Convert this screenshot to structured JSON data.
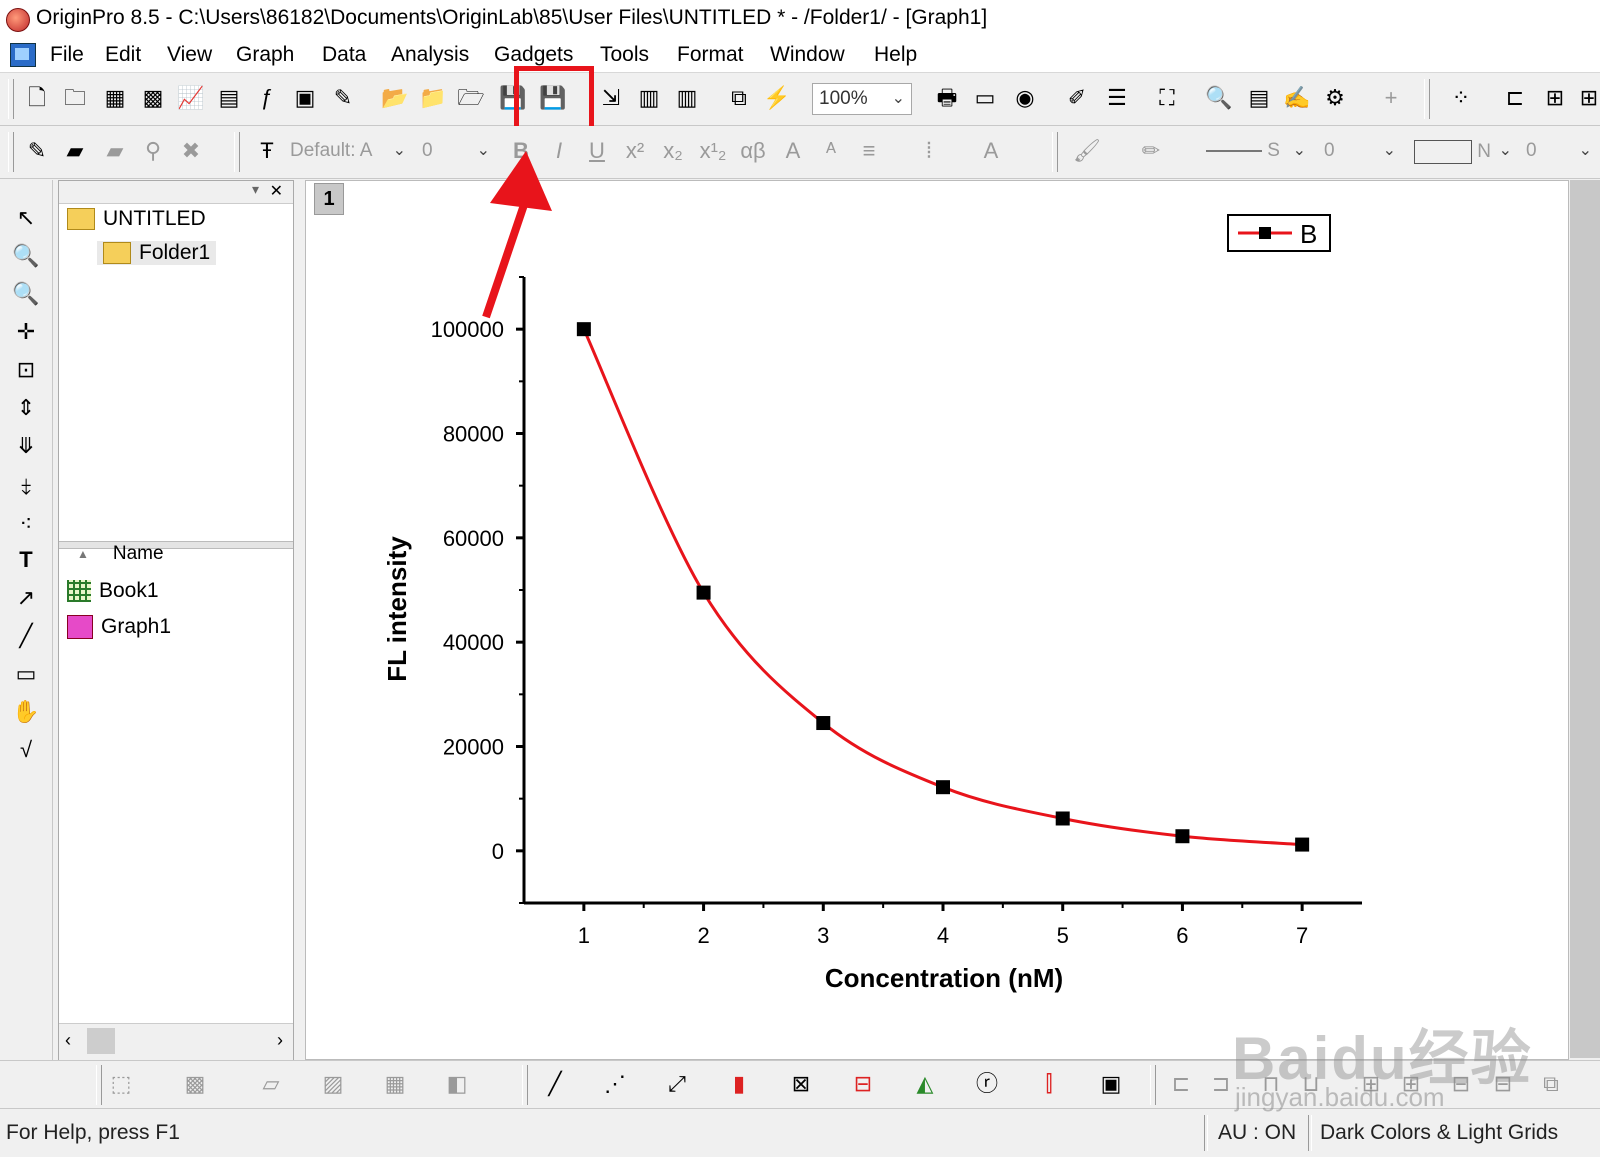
{
  "window": {
    "title": "OriginPro 8.5 - C:\\Users\\86182\\Documents\\OriginLab\\85\\User Files\\UNTITLED * - /Folder1/ - [Graph1]"
  },
  "menu": [
    "File",
    "Edit",
    "View",
    "Graph",
    "Data",
    "Analysis",
    "Gadgets",
    "Tools",
    "Format",
    "Window",
    "Help"
  ],
  "toolbar": {
    "zoom": "100%",
    "font_name": "Default: A",
    "font_size": "0",
    "line_style_label": "S",
    "line_width": "0",
    "pattern_label": "N",
    "pattern_width": "0",
    "highlighted_button": "save-template-icon"
  },
  "explorer": {
    "root": "UNTITLED",
    "folder": "Folder1",
    "column_header": "Name",
    "items": [
      "Book1",
      "Graph1"
    ]
  },
  "graph": {
    "layer_number": "1"
  },
  "chart_data": {
    "type": "line",
    "x": [
      1,
      2,
      3,
      4,
      5,
      6,
      7
    ],
    "series": [
      {
        "name": "B",
        "values": [
          100000,
          49500,
          24500,
          12200,
          6200,
          2800,
          1200
        ],
        "color": "#e8141b",
        "marker": "square"
      }
    ],
    "xlabel": "Concentration (nM)",
    "ylabel": "FL intensity",
    "xlim": [
      0.5,
      7.5
    ],
    "ylim": [
      -10000,
      110000
    ],
    "xticks": [
      "1",
      "2",
      "3",
      "4",
      "5",
      "6",
      "7"
    ],
    "yticks": [
      "0",
      "20000",
      "40000",
      "60000",
      "80000",
      "100000"
    ],
    "grid": false,
    "legend": "top-right"
  },
  "status": {
    "help": "For Help, press F1",
    "au": "AU : ON",
    "theme": "Dark Colors & Light Grids"
  },
  "watermark": {
    "brand": "Baidu经验",
    "url": "jingyan.baidu.com"
  },
  "colors": {
    "accent_red": "#e8141b",
    "curve": "#e8141b"
  }
}
